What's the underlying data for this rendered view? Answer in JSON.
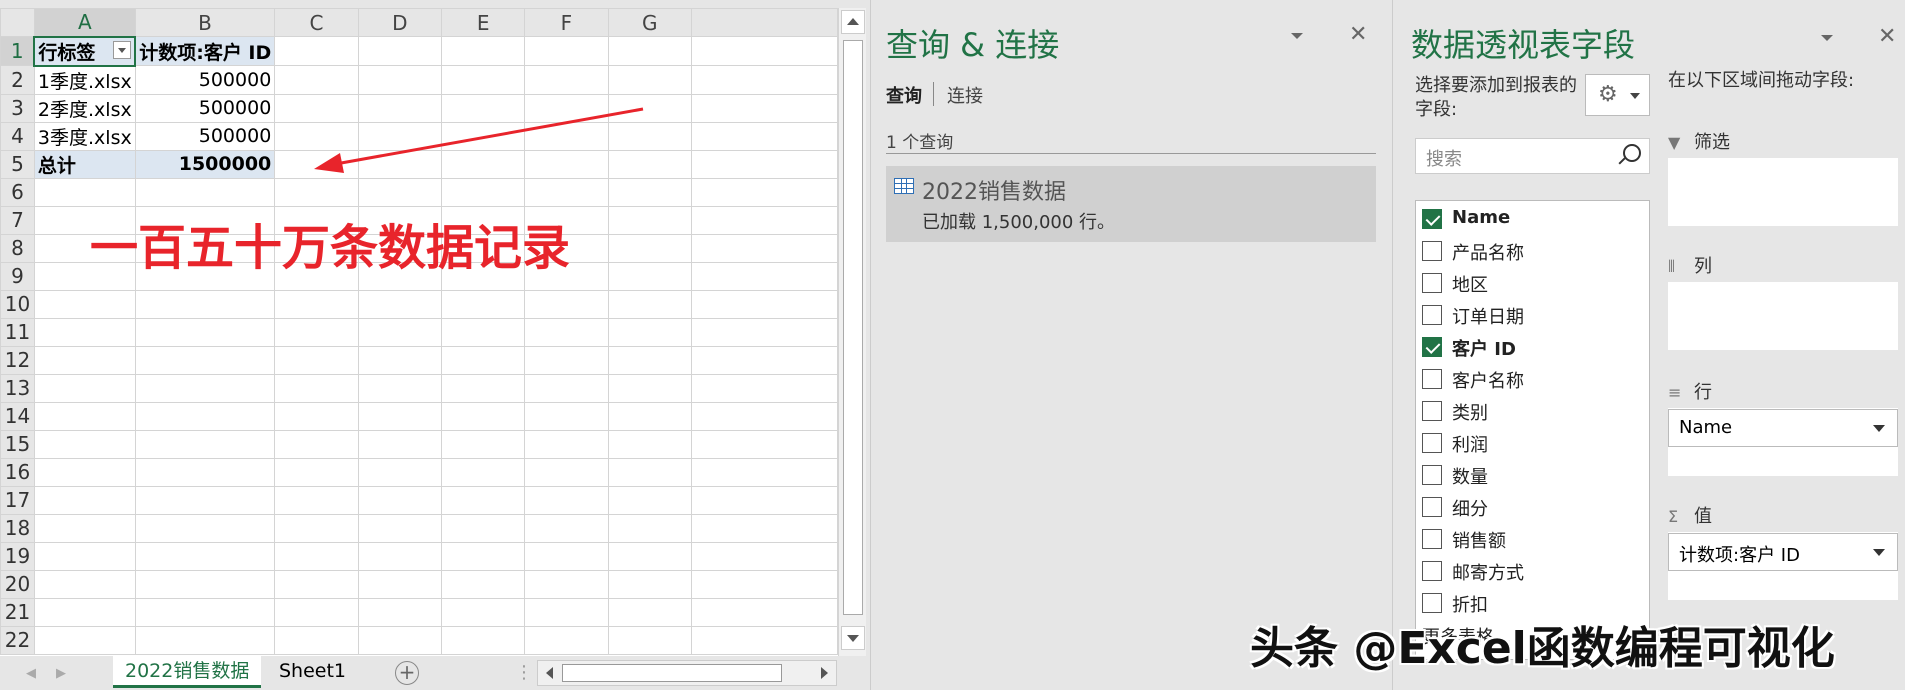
{
  "sheet": {
    "columns": [
      "A",
      "B",
      "C",
      "D",
      "E",
      "F",
      "G"
    ],
    "rows": [
      "1",
      "2",
      "3",
      "4",
      "5",
      "6",
      "7",
      "8",
      "9",
      "10",
      "11",
      "12",
      "13",
      "14",
      "15",
      "16",
      "17",
      "18",
      "19",
      "20",
      "21",
      "22"
    ],
    "cells": {
      "a1": "行标签",
      "b1": "计数项:客户 ID",
      "a2": "1季度.xlsx",
      "b2": "500000",
      "a3": "2季度.xlsx",
      "b3": "500000",
      "a4": "3季度.xlsx",
      "b4": "500000",
      "a5": "总计",
      "b5": "1500000"
    },
    "annotation": "一百五十万条数据记录",
    "tabs": [
      "2022销售数据",
      "Sheet1"
    ]
  },
  "query_pane": {
    "title": "查询 & 连接",
    "tabs": [
      "查询",
      "连接"
    ],
    "count": "1 个查询",
    "item_name": "2022销售数据",
    "item_status": "已加载 1,500,000 行。"
  },
  "pivot_pane": {
    "title": "数据透视表字段",
    "choose_hint": "选择要添加到报表的字段:",
    "search_placeholder": "搜索",
    "fields": [
      {
        "label": "Name",
        "checked": true
      },
      {
        "label": "产品名称",
        "checked": false
      },
      {
        "label": "地区",
        "checked": false
      },
      {
        "label": "订单日期",
        "checked": false
      },
      {
        "label": "客户 ID",
        "checked": true
      },
      {
        "label": "客户名称",
        "checked": false
      },
      {
        "label": "类别",
        "checked": false
      },
      {
        "label": "利润",
        "checked": false
      },
      {
        "label": "数量",
        "checked": false
      },
      {
        "label": "细分",
        "checked": false
      },
      {
        "label": "销售额",
        "checked": false
      },
      {
        "label": "邮寄方式",
        "checked": false
      },
      {
        "label": "折扣",
        "checked": false
      },
      {
        "label": "更多表格...",
        "checked": false
      }
    ],
    "area_hint": "在以下区域间拖动字段:",
    "areas": {
      "filter": "筛选",
      "columns": "列",
      "rows": "行",
      "values": "值"
    },
    "rows_field": "Name",
    "values_field": "计数项:客户 ID"
  },
  "watermark": "头条 @Excel函数编程可视化",
  "colors": {
    "accent": "#217346",
    "annotation": "#e8242b",
    "pivot_header_fill": "#dce6f1"
  }
}
